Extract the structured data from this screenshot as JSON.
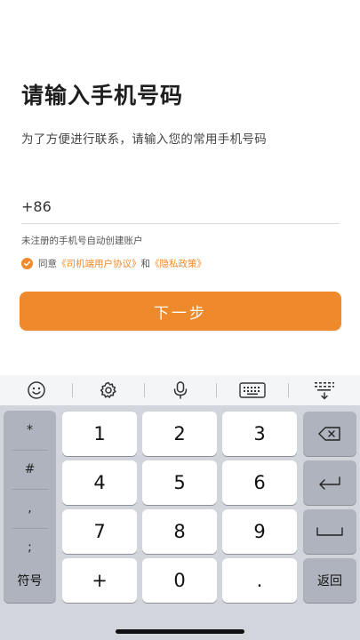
{
  "header": {
    "title": "请输入手机号码",
    "subtitle": "为了方便进行联系，请输入您的常用手机号码"
  },
  "phone": {
    "country_code": "+86",
    "value": "",
    "placeholder": ""
  },
  "hint": "未注册的手机号自动创建账户",
  "agreement": {
    "prefix": "同意",
    "user_agreement": "《司机端用户协议》",
    "and": "和",
    "privacy_policy": "《隐私政策》",
    "checked": true
  },
  "next_button": "下一步",
  "colors": {
    "accent": "#ee8a2c",
    "keyboard_bg": "#d3d5dc",
    "function_key": "#aeb3bd"
  },
  "keyboard": {
    "toolbar_icons": [
      "emoji-icon",
      "gear-icon",
      "microphone-icon",
      "keyboard-icon",
      "collapse-keyboard-icon"
    ],
    "symbols": [
      "*",
      "#",
      ",",
      ";"
    ],
    "digits": [
      "1",
      "2",
      "3",
      "4",
      "5",
      "6",
      "7",
      "8",
      "9",
      "0"
    ],
    "plus": "+",
    "dot": ".",
    "symbols_key": "符号",
    "return_key": "返回",
    "backspace_icon": "backspace-icon",
    "enter_icon": "enter-icon",
    "space_icon": "space-icon"
  }
}
